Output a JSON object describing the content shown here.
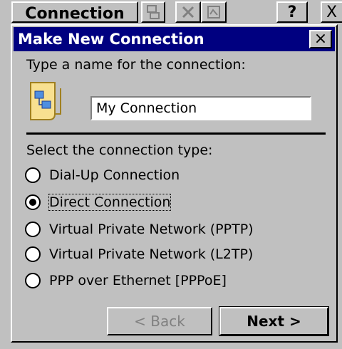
{
  "background": {
    "title_button_label": "Connection",
    "help_label": "?",
    "close_label": "X"
  },
  "dialog": {
    "title": "Make New Connection",
    "close_label": "×",
    "name_prompt": "Type a name for the connection:",
    "name_value": "My Connection",
    "type_prompt": "Select the connection type:",
    "options": [
      {
        "label": "Dial-Up Connection",
        "checked": false
      },
      {
        "label": "Direct Connection",
        "checked": true
      },
      {
        "label": "Virtual Private Network (PPTP)",
        "checked": false
      },
      {
        "label": "Virtual Private Network (L2TP)",
        "checked": false
      },
      {
        "label": "PPP over Ethernet [PPPoE]",
        "checked": false
      }
    ],
    "back_label": "< Back",
    "next_label": "Next >"
  }
}
